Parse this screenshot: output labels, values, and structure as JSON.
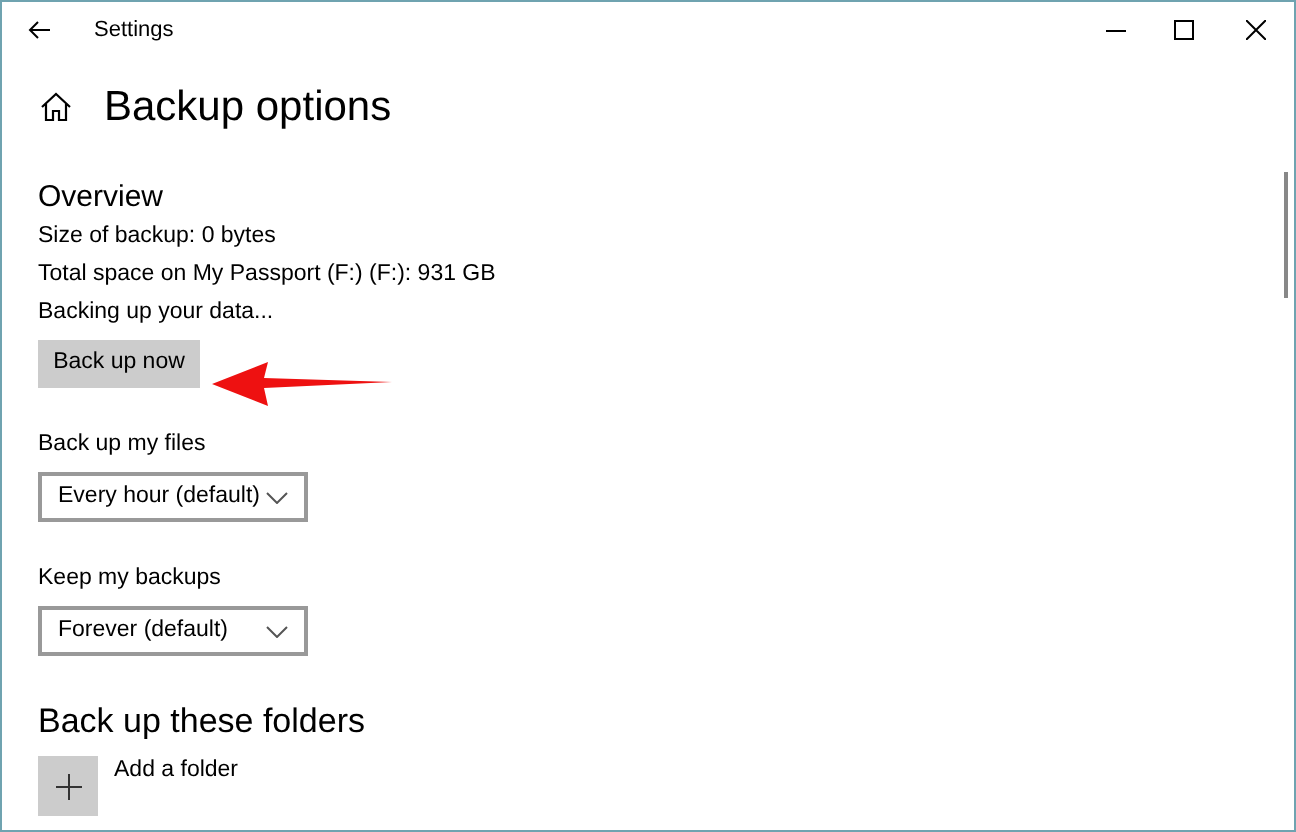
{
  "window": {
    "title": "Settings"
  },
  "page": {
    "title": "Backup options"
  },
  "overview": {
    "heading": "Overview",
    "lines": [
      "Size of backup: 0 bytes",
      "Total space on My Passport (F:) (F:): 931 GB",
      "Backing up your data..."
    ],
    "button": "Back up now"
  },
  "dropdowns": [
    {
      "label": "Back up my files",
      "value": "Every hour (default)"
    },
    {
      "label": "Keep my backups",
      "value": "Forever (default)"
    }
  ],
  "folders": {
    "heading": "Back up these folders",
    "add_label": "Add a folder"
  }
}
